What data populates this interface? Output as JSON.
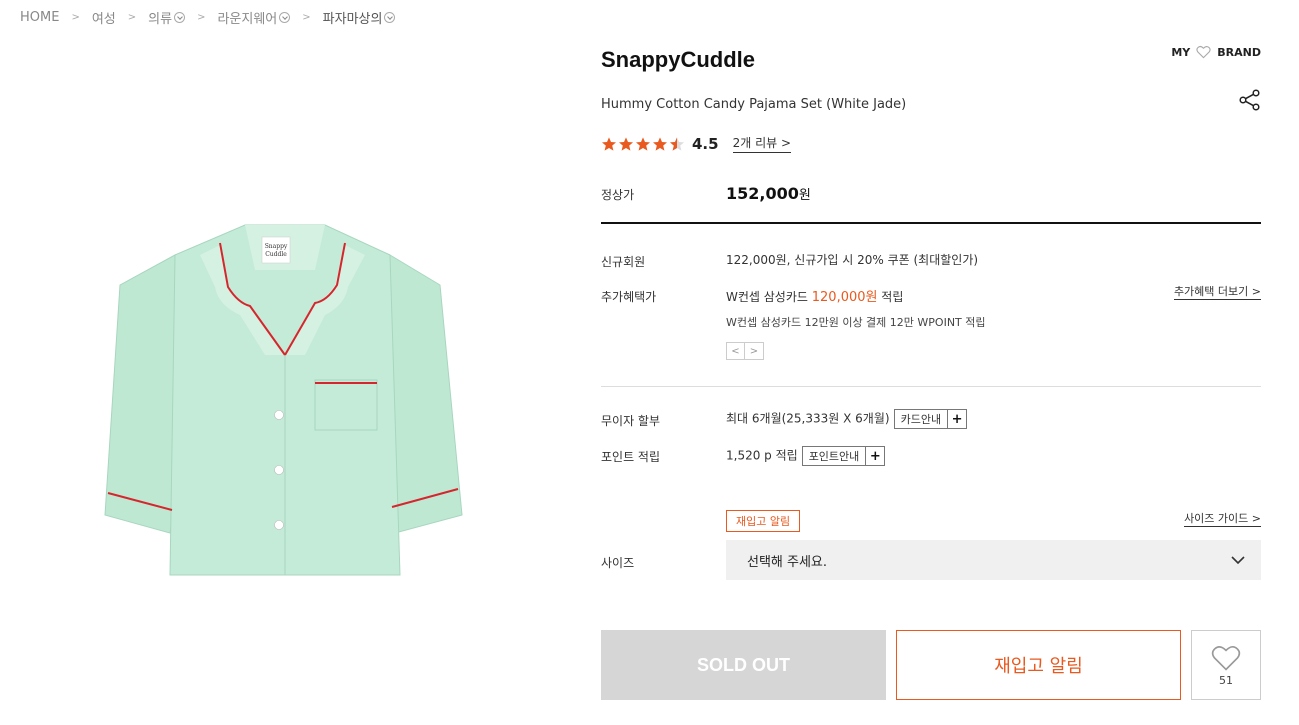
{
  "breadcrumb": {
    "home": "HOME",
    "women": "여성",
    "clothing": "의류",
    "loungewear": "라운지웨어",
    "pajama_tops": "파자마상의"
  },
  "product": {
    "brand": "SnappyCuddle",
    "title": "Hummy Cotton Candy Pajama Set (White Jade)",
    "rating_value": 4.5,
    "rating": "4.5",
    "review_count": "2개 리뷰",
    "image_label_line1": "Snappy",
    "image_label_line2": "Cuddle"
  },
  "header": {
    "my": "MY",
    "brand": "BRAND"
  },
  "price": {
    "label": "정상가",
    "value": "152,000",
    "unit": "원"
  },
  "benefits": {
    "new_member_label": "신규회원",
    "new_member_value": "122,000원, 신규가입 시 20% 쿠폰 (최대할인가)",
    "extra_label": "추가혜택가",
    "extra_card": "W컨셉 삼성카드",
    "extra_price": "120,000원",
    "extra_suffix": "적립",
    "extra_note": "W컨셉 삼성카드 12만원 이상 결제 12만 WPOINT 적립",
    "more_link": "추가혜택 더보기"
  },
  "installment": {
    "label": "무이자 할부",
    "value": "최대 6개월(25,333원 X 6개월)",
    "button": "카드안내"
  },
  "points": {
    "label": "포인트 적립",
    "value": "1,520 p 적립",
    "button": "포인트안내"
  },
  "size": {
    "label": "사이즈",
    "restock_badge": "재입고 알림",
    "guide_link": "사이즈 가이드",
    "placeholder": "선택해 주세요."
  },
  "actions": {
    "soldout": "SOLD OUT",
    "restock": "재입고 알림",
    "like_count": "51"
  },
  "colors": {
    "accent": "#e85a1f",
    "pajama": "#bfe8d3",
    "piping": "#d6262d"
  }
}
